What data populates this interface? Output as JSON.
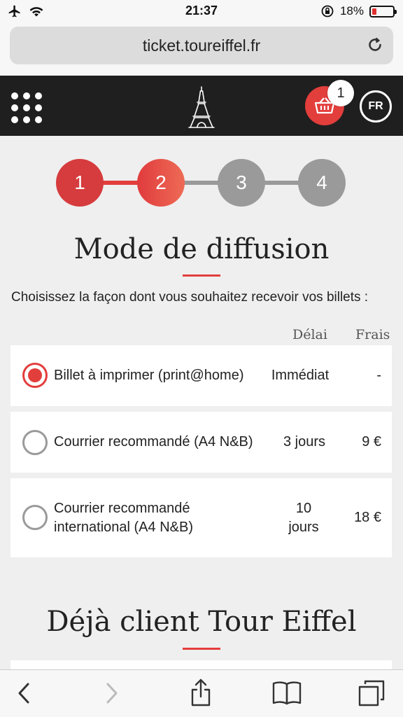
{
  "status_bar": {
    "time": "21:37",
    "battery": "18%"
  },
  "browser": {
    "url": "ticket.toureiffel.fr"
  },
  "header": {
    "cart_count": "1",
    "language": "FR"
  },
  "stepper": {
    "steps": [
      "1",
      "2",
      "3",
      "4"
    ],
    "current": 2
  },
  "section1": {
    "title": "Mode de diffusion",
    "intro": "Choisissez la façon dont vous souhaitez recevoir vos billets :",
    "col_delay": "Délai",
    "col_fee": "Frais",
    "options": [
      {
        "label": "Billet à imprimer (print@home)",
        "delay": "Immédiat",
        "fee": "-",
        "selected": true
      },
      {
        "label": "Courrier recommandé (A4 N&B)",
        "delay": "3 jours",
        "fee": "9 €",
        "selected": false
      },
      {
        "label_line1": "Courrier recommandé",
        "label_line2": "international (A4 N&B)",
        "delay_line1": "10",
        "delay_line2": "jours",
        "fee": "18 €",
        "selected": false
      }
    ]
  },
  "section2": {
    "title": "Déjà client Tour Eiffel"
  },
  "colors": {
    "accent": "#e23e3c",
    "header_bg": "#1f1f1f",
    "inactive": "#9a9a9a",
    "page_bg": "#efefef"
  }
}
